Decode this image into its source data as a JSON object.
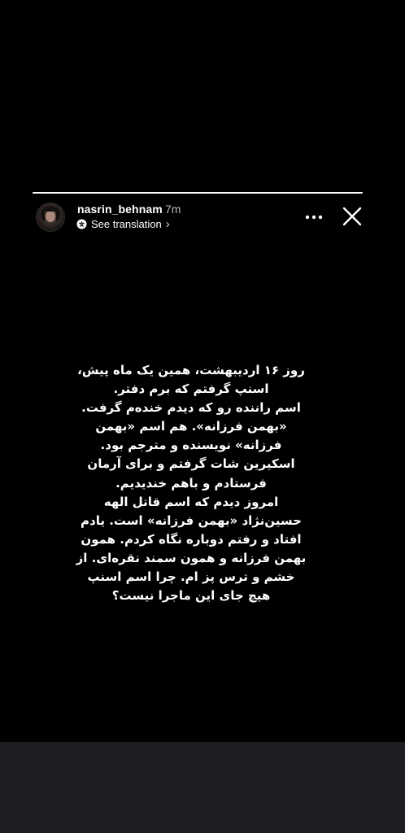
{
  "header": {
    "username": "nasrin_behnam",
    "timestamp": "7m",
    "see_translation": "See translation",
    "translation_chevron": "›",
    "more_icon": "more-horizontal-icon",
    "close_icon": "close-icon"
  },
  "progress": {
    "fraction": 1.0
  },
  "story": {
    "text": "روز ۱۶ اردیبهشت، همین یک ماه پیش،\nاسنپ گرفتم که برم دفتر.\nاسم راننده رو که دیدم خنده‌م گرفت.\n«بهمن فرزانه». هم اسم «بهمن\nفرزانه» نویسنده و مترجم بود.\nاسکیرین شات گرفتم و برای آرمان\nفرستادم و باهم خندیدیم.\nامروز دیدم که اسم قاتل الهه\nحسین‌نژاد «بهمن فرزانه» است. یادم\nافتاد و رفتم دوباره نگاه کردم. همون\nبهمن فرزانه و همون سمند نقره‌ای. از\nخشم و ترس پز ام. چرا اسم اسنپ\nهیچ جای این ماجرا نیست؟"
  },
  "colors": {
    "story_background": "#000000",
    "screen_background": "#1c1e22",
    "text": "#ffffff",
    "timestamp": "#bdbdbd"
  }
}
